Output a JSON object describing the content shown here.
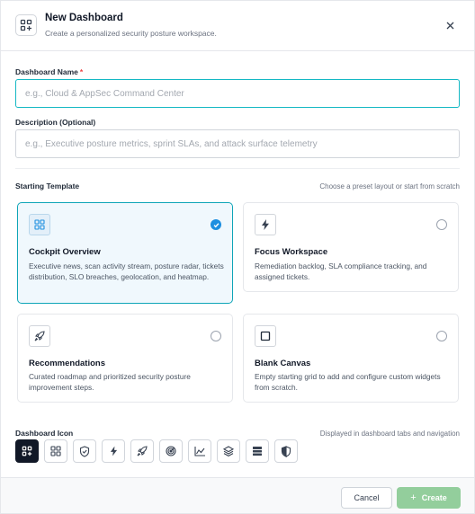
{
  "header": {
    "title": "New Dashboard",
    "subtitle": "Create a personalized security posture workspace.",
    "icon": "dashboard-add-icon",
    "close_label": "×"
  },
  "form": {
    "name_label": "Dashboard Name",
    "name_required_mark": "*",
    "name_value": "",
    "name_placeholder": "e.g., Cloud & AppSec Command Center",
    "description_label": "Description (Optional)",
    "description_value": "",
    "description_placeholder": "e.g., Executive posture metrics, sprint SLAs, and attack surface telemetry"
  },
  "templates": {
    "title": "Starting Template",
    "hint": "Choose a preset layout or start from scratch",
    "items": [
      {
        "title": "Cockpit Overview",
        "description": "Executive news, scan activity stream, posture radar, tickets distribution, SLO breaches, geolocation, and heatmap.",
        "icon": "grid-icon",
        "selected": true
      },
      {
        "title": "Focus Workspace",
        "description": "Remediation backlog, SLA compliance tracking, and assigned tickets.",
        "icon": "bolt-icon",
        "selected": false
      },
      {
        "title": "Recommendations",
        "description": "Curated roadmap and prioritized security posture improvement steps.",
        "icon": "rocket-icon",
        "selected": false
      },
      {
        "title": "Blank Canvas",
        "description": "Empty starting grid to add and configure custom widgets from scratch.",
        "icon": "square-icon",
        "selected": false
      }
    ]
  },
  "icon_picker": {
    "title": "Dashboard Icon",
    "hint": "Displayed in dashboard tabs and navigation",
    "selected_index": 0,
    "options": [
      "dashboard-add-icon",
      "grid-icon",
      "shield-check-icon",
      "bolt-icon",
      "rocket-icon",
      "radar-icon",
      "area-chart-icon",
      "layers-icon",
      "server-icon",
      "shield-half-icon"
    ]
  },
  "footer": {
    "cancel_label": "Cancel",
    "create_label": "Create",
    "create_icon": "plus-icon"
  },
  "colors": {
    "accent": "#1d8fe0",
    "selected_border": "#0ea5b7",
    "selected_bg": "#f0f8fd",
    "create_button": "#93ce9c",
    "required": "#ef4444",
    "icon_selected_bg": "#111827"
  }
}
